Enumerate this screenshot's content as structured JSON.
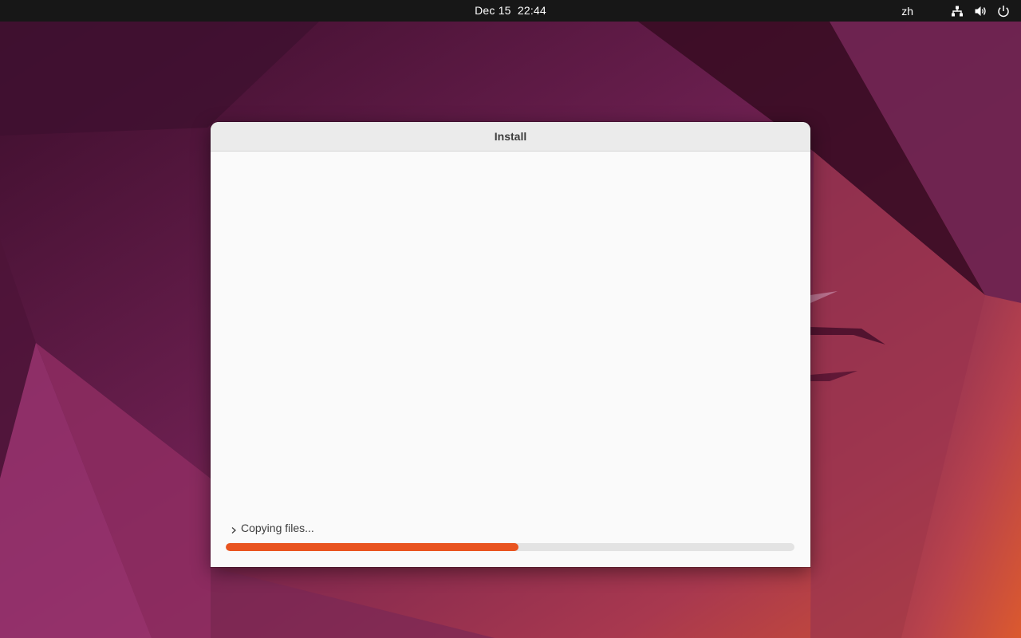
{
  "topbar": {
    "datetime": "Dec 15  22:44",
    "input_language": "zh",
    "icons": [
      "network-icon",
      "volume-icon",
      "power-icon"
    ]
  },
  "window": {
    "title": "Install",
    "status_text": "Copying files...",
    "progress_fraction": 0.515,
    "accent_color": "#e95420"
  }
}
